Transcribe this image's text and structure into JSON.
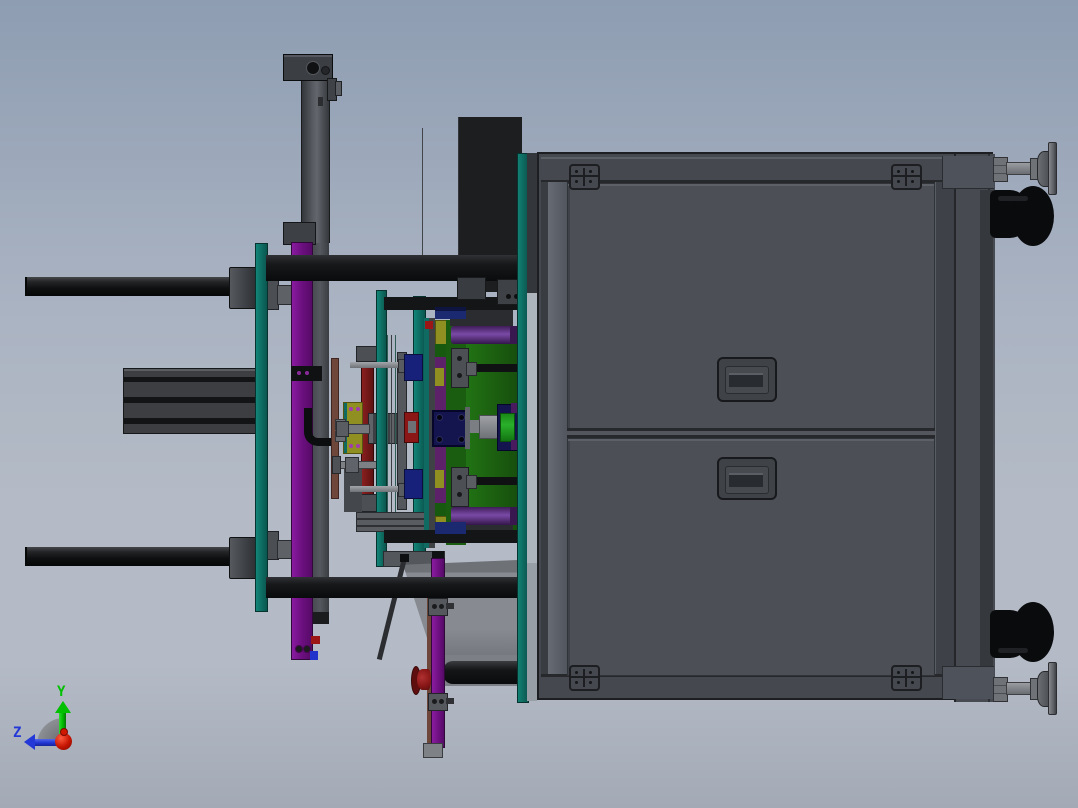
{
  "viewport": {
    "type": "cad-3d-viewport",
    "view_orientation": "right side view",
    "model_description": "machine assembly: cabinet base frame with two door panels, leveling feet, cable elbows, tie bars, mold tooling stack with platens and ejector"
  },
  "axis_triad": {
    "y_label": "Y",
    "z_label": "Z"
  },
  "components": [
    "cabinet-base",
    "door-panel-upper",
    "door-panel-lower",
    "door-handle",
    "hinge",
    "leveling-foot",
    "cable-elbow",
    "tie-rod",
    "tie-rod-collar",
    "main-tie-bar",
    "teal-platen",
    "purple-side-plate",
    "support-post",
    "finned-extrusion",
    "mold-core-plate",
    "ejector-cylinder",
    "guide-pin",
    "center-shaft",
    "bushing",
    "emergency-knob",
    "chute-panel",
    "outrigger-strip",
    "axis-triad"
  ],
  "palette": {
    "bg_top": "#8e9db2",
    "bg_mid": "#aab3c2",
    "bg_low": "#b4bbc6",
    "bg_bottom": "#a3aab6",
    "bar_dark": "#0a0b0c",
    "bar_mid": "#17181a",
    "bar_hi": "#2f3134",
    "collar": "#3e4146",
    "steel": "#55585d",
    "steel_light": "#8a8d92",
    "steel_mid": "#6e7176",
    "steel_dark": "#3a3d42",
    "steel_edge": "#17181a",
    "post_light": "#63676d",
    "post_dark": "#34373b",
    "teal": "#0f6b62",
    "teal_hi": "#128578",
    "teal_lo": "#0a564e",
    "teal_edge": "#06332e",
    "purple": "#6e1082",
    "purple_hi": "#8a1ba0",
    "purple_edge": "#30083a",
    "purple_cyl": "#5a2c7e",
    "purple_cyl_hi": "#7a4aa6",
    "purple_cyl_lo": "#3f1d58",
    "purple_cap": "#4a1a5e",
    "purple_strip": "#5c2168",
    "maroon": "#701a1a",
    "maroon_hi": "#8a1f1f",
    "brown": "#6f463a",
    "yellow": "#8f8f22",
    "yellow_edge": "#55550f",
    "green_a": "#1a5c10",
    "green_b": "#1d6413",
    "green_dark": "#134a0c",
    "green_hi": "#217314",
    "green_bright": "#2ab02a",
    "green_bright_lo": "#127312",
    "blue_flat": "#1b2a70",
    "navy": "#14154e",
    "navy_edge": "#06062a",
    "blue_deep": "#0d1440",
    "blue_vivid": "#2233cc",
    "blue_mold": "#18217a",
    "red_knob": "#8a1717",
    "red_knob_dark": "#5e0e0e",
    "red_accent": "#9c1616",
    "cab_frame": "#45484e",
    "cab_frame_dark": "#26282c",
    "cab_panel": "#4c4f55",
    "cab_panel_edge": "#303338",
    "cab_line": "#1c1e21",
    "cab_col_light": "#676b74",
    "cab_col": "#51555d",
    "cab_inner_dark": "#393c41",
    "cab_corner": "#4e525a",
    "gap_light": "#aeb4bc",
    "gap_mid": "#989ea6",
    "gap_dark": "#33363b",
    "chute": "#878b91",
    "chute_dark": "#6e7176",
    "chute_low": "#7c8086",
    "black_box": "#1d1e20",
    "axis_green": "#00c000",
    "axis_blue": "#2438d8",
    "axis_red": "#c41400",
    "arc_gray": "#8f9398"
  }
}
